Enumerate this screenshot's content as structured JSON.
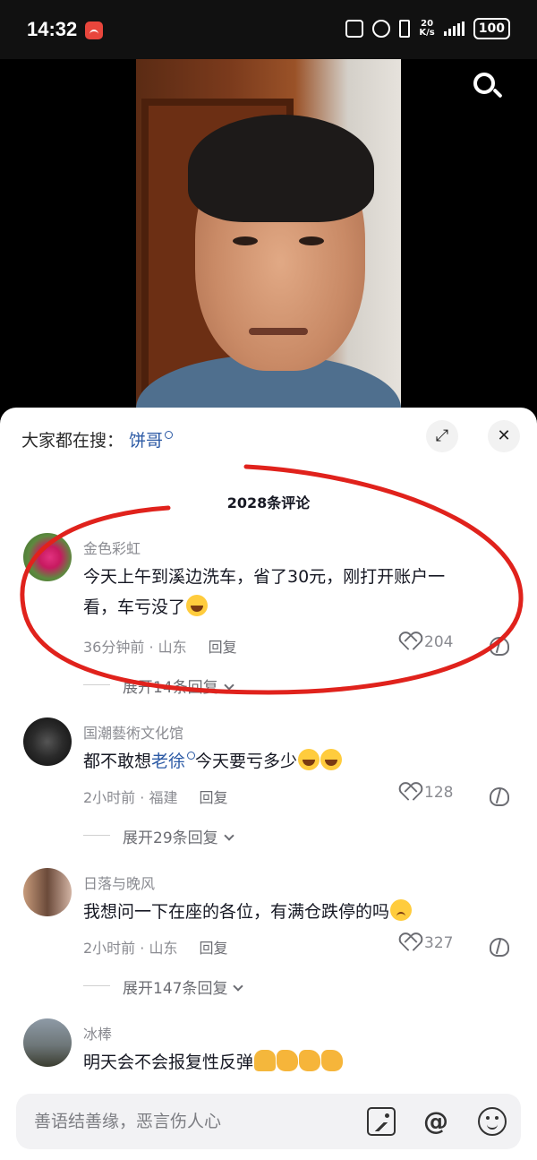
{
  "status_bar": {
    "time": "14:32",
    "network_speed_value": "20",
    "network_speed_unit": "K/s",
    "battery": "100"
  },
  "comments_panel": {
    "search_hint_label": "大家都在搜：",
    "search_hint_keyword": "饼哥",
    "title": "2028条评论"
  },
  "comments": [
    {
      "user": "金色彩虹",
      "text_line1": "今天上午到溪边洗车，省了30元，刚打开账户一",
      "text_line2": "看，车亏没了",
      "time": "36分钟前 · 山东",
      "reply_label": "回复",
      "likes": "204",
      "expand_label": "展开14条回复"
    },
    {
      "user": "国潮藝術文化馆",
      "text_before": "都不敢想",
      "text_keyword": "老徐",
      "text_after": "今天要亏多少",
      "time": "2小时前 · 福建",
      "reply_label": "回复",
      "likes": "128",
      "expand_label": "展开29条回复"
    },
    {
      "user": "日落与晚风",
      "text": "我想问一下在座的各位，有满仓跌停的吗",
      "time": "2小时前 · 山东",
      "reply_label": "回复",
      "likes": "327",
      "expand_label": "展开147条回复"
    },
    {
      "user": "冰棒",
      "text": "明天会不会报复性反弹"
    }
  ],
  "input_bar": {
    "placeholder": "善语结善缘，恶言伤人心"
  },
  "colors": {
    "keyword_blue": "#2c5aa5",
    "annotation_red": "#e0221c",
    "secondary_text": "#8a8b91"
  }
}
